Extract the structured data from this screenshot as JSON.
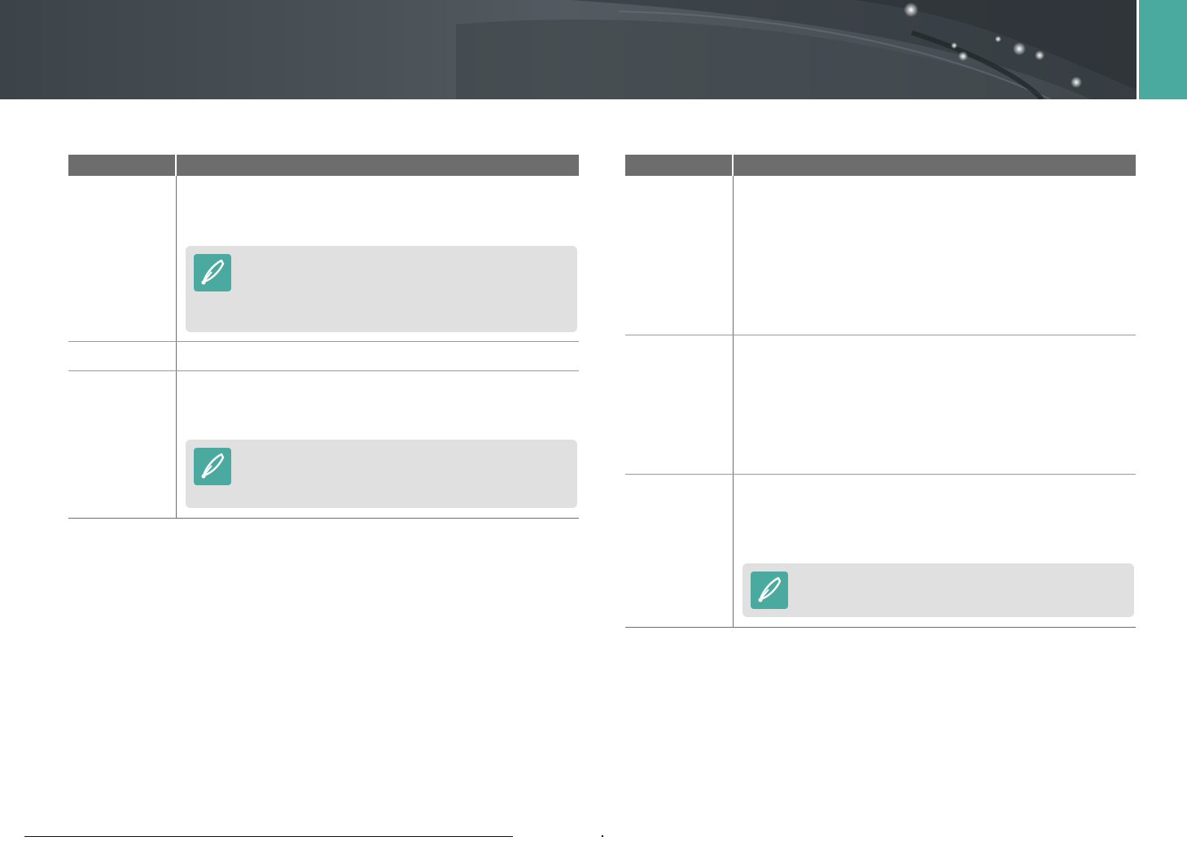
{
  "banner": {
    "icons": [
      "lens-arc-decoration",
      "light-sparkle"
    ]
  },
  "side_tab": {
    "accent_color": "#4aaaa0"
  },
  "colors": {
    "table_header": "#6d6d6d",
    "note_background": "#e0e0e0",
    "accent": "#4aaaa0"
  },
  "left_table": {
    "notes": [
      {
        "icon": "pen-nib-note-icon"
      },
      {
        "icon": "pen-nib-note-icon"
      }
    ]
  },
  "right_table": {
    "notes": [
      {
        "icon": "pen-nib-note-icon"
      }
    ]
  }
}
